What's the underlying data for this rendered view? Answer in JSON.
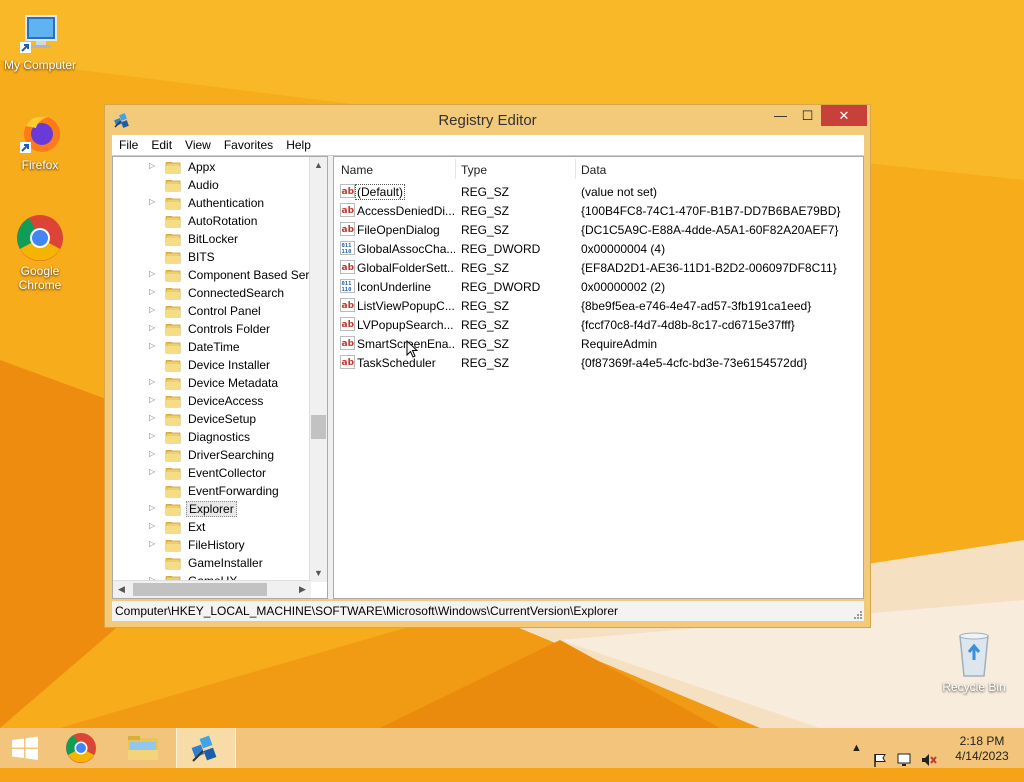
{
  "desktop": {
    "icons": [
      {
        "label": "My Computer"
      },
      {
        "label": "Firefox"
      },
      {
        "label": "Google Chrome"
      },
      {
        "label": "Recycle Bin"
      }
    ]
  },
  "window": {
    "title": "Registry Editor",
    "buttons": {
      "minimize": "—",
      "maximize": "☐",
      "close": "✕"
    },
    "menu": [
      "File",
      "Edit",
      "View",
      "Favorites",
      "Help"
    ],
    "tree": {
      "items": [
        {
          "label": "Appx",
          "expandable": true
        },
        {
          "label": "Audio",
          "expandable": false
        },
        {
          "label": "Authentication",
          "expandable": true
        },
        {
          "label": "AutoRotation",
          "expandable": false
        },
        {
          "label": "BitLocker",
          "expandable": false
        },
        {
          "label": "BITS",
          "expandable": false
        },
        {
          "label": "Component Based Serv",
          "expandable": true
        },
        {
          "label": "ConnectedSearch",
          "expandable": true
        },
        {
          "label": "Control Panel",
          "expandable": true
        },
        {
          "label": "Controls Folder",
          "expandable": true
        },
        {
          "label": "DateTime",
          "expandable": true
        },
        {
          "label": "Device Installer",
          "expandable": false
        },
        {
          "label": "Device Metadata",
          "expandable": true
        },
        {
          "label": "DeviceAccess",
          "expandable": true
        },
        {
          "label": "DeviceSetup",
          "expandable": true
        },
        {
          "label": "Diagnostics",
          "expandable": true
        },
        {
          "label": "DriverSearching",
          "expandable": true
        },
        {
          "label": "EventCollector",
          "expandable": true
        },
        {
          "label": "EventForwarding",
          "expandable": false
        },
        {
          "label": "Explorer",
          "expandable": true,
          "selected": true
        },
        {
          "label": "Ext",
          "expandable": true
        },
        {
          "label": "FileHistory",
          "expandable": true
        },
        {
          "label": "GameInstaller",
          "expandable": false
        },
        {
          "label": "GameUX",
          "expandable": true
        }
      ]
    },
    "list": {
      "columns": [
        "Name",
        "Type",
        "Data"
      ],
      "rows": [
        {
          "name": "(Default)",
          "type": "REG_SZ",
          "data": "(value not set)",
          "icon": "string-value-icon"
        },
        {
          "name": "AccessDeniedDi...",
          "type": "REG_SZ",
          "data": "{100B4FC8-74C1-470F-B1B7-DD7B6BAE79BD}",
          "icon": "string-value-icon"
        },
        {
          "name": "FileOpenDialog",
          "type": "REG_SZ",
          "data": "{DC1C5A9C-E88A-4dde-A5A1-60F82A20AEF7}",
          "icon": "string-value-icon"
        },
        {
          "name": "GlobalAssocCha...",
          "type": "REG_DWORD",
          "data": "0x00000004 (4)",
          "icon": "binary-value-icon"
        },
        {
          "name": "GlobalFolderSett...",
          "type": "REG_SZ",
          "data": "{EF8AD2D1-AE36-11D1-B2D2-006097DF8C11}",
          "icon": "string-value-icon"
        },
        {
          "name": "IconUnderline",
          "type": "REG_DWORD",
          "data": "0x00000002 (2)",
          "icon": "binary-value-icon"
        },
        {
          "name": "ListViewPopupC...",
          "type": "REG_SZ",
          "data": "{8be9f5ea-e746-4e47-ad57-3fb191ca1eed}",
          "icon": "string-value-icon"
        },
        {
          "name": "LVPopupSearch...",
          "type": "REG_SZ",
          "data": "{fccf70c8-f4d7-4d8b-8c17-cd6715e37fff}",
          "icon": "string-value-icon"
        },
        {
          "name": "SmartScreenEna...",
          "type": "REG_SZ",
          "data": "RequireAdmin",
          "icon": "string-value-icon"
        },
        {
          "name": "TaskScheduler",
          "type": "REG_SZ",
          "data": "{0f87369f-a4e5-4cfc-bd3e-73e6154572dd}",
          "icon": "string-value-icon"
        }
      ]
    },
    "status_path": "Computer\\HKEY_LOCAL_MACHINE\\SOFTWARE\\Microsoft\\Windows\\CurrentVersion\\Explorer"
  },
  "taskbar": {
    "time": "2:18 PM",
    "date": "4/14/2023"
  }
}
